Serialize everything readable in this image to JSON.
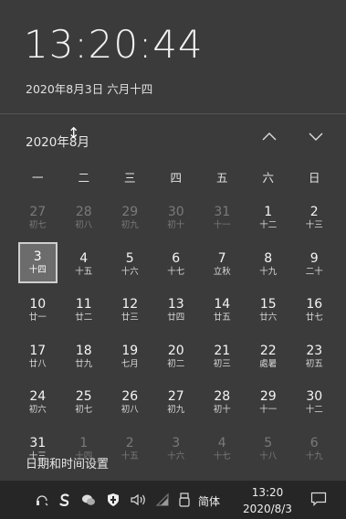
{
  "clock": {
    "time": "13:20:44",
    "long_date": "2020年8月3日 六月十四"
  },
  "calendar": {
    "month_label": "2020年8月",
    "weekdays": [
      "一",
      "二",
      "三",
      "四",
      "五",
      "六",
      "日"
    ],
    "days": [
      {
        "num": "27",
        "lunar": "初七",
        "dim": true
      },
      {
        "num": "28",
        "lunar": "初八",
        "dim": true
      },
      {
        "num": "29",
        "lunar": "初九",
        "dim": true
      },
      {
        "num": "30",
        "lunar": "初十",
        "dim": true
      },
      {
        "num": "31",
        "lunar": "十一",
        "dim": true
      },
      {
        "num": "1",
        "lunar": "十二",
        "dim": false
      },
      {
        "num": "2",
        "lunar": "十三",
        "dim": false
      },
      {
        "num": "3",
        "lunar": "十四",
        "dim": false,
        "today": true
      },
      {
        "num": "4",
        "lunar": "十五",
        "dim": false
      },
      {
        "num": "5",
        "lunar": "十六",
        "dim": false
      },
      {
        "num": "6",
        "lunar": "十七",
        "dim": false
      },
      {
        "num": "7",
        "lunar": "立秋",
        "dim": false
      },
      {
        "num": "8",
        "lunar": "十九",
        "dim": false
      },
      {
        "num": "9",
        "lunar": "二十",
        "dim": false
      },
      {
        "num": "10",
        "lunar": "廿一",
        "dim": false
      },
      {
        "num": "11",
        "lunar": "廿二",
        "dim": false
      },
      {
        "num": "12",
        "lunar": "廿三",
        "dim": false
      },
      {
        "num": "13",
        "lunar": "廿四",
        "dim": false
      },
      {
        "num": "14",
        "lunar": "廿五",
        "dim": false
      },
      {
        "num": "15",
        "lunar": "廿六",
        "dim": false
      },
      {
        "num": "16",
        "lunar": "廿七",
        "dim": false
      },
      {
        "num": "17",
        "lunar": "廿八",
        "dim": false
      },
      {
        "num": "18",
        "lunar": "廿九",
        "dim": false
      },
      {
        "num": "19",
        "lunar": "七月",
        "dim": false
      },
      {
        "num": "20",
        "lunar": "初二",
        "dim": false
      },
      {
        "num": "21",
        "lunar": "初三",
        "dim": false
      },
      {
        "num": "22",
        "lunar": "處暑",
        "dim": false
      },
      {
        "num": "23",
        "lunar": "初五",
        "dim": false
      },
      {
        "num": "24",
        "lunar": "初六",
        "dim": false
      },
      {
        "num": "25",
        "lunar": "初七",
        "dim": false
      },
      {
        "num": "26",
        "lunar": "初八",
        "dim": false
      },
      {
        "num": "27",
        "lunar": "初九",
        "dim": false
      },
      {
        "num": "28",
        "lunar": "初十",
        "dim": false
      },
      {
        "num": "29",
        "lunar": "十一",
        "dim": false
      },
      {
        "num": "30",
        "lunar": "十二",
        "dim": false
      },
      {
        "num": "31",
        "lunar": "十三",
        "dim": false
      },
      {
        "num": "1",
        "lunar": "十四",
        "dim": true
      },
      {
        "num": "2",
        "lunar": "十五",
        "dim": true
      },
      {
        "num": "3",
        "lunar": "十六",
        "dim": true
      },
      {
        "num": "4",
        "lunar": "十七",
        "dim": true
      },
      {
        "num": "5",
        "lunar": "十八",
        "dim": true
      },
      {
        "num": "6",
        "lunar": "十九",
        "dim": true
      }
    ]
  },
  "settings_link": "日期和时间设置",
  "taskbar": {
    "ime_label": "简体",
    "time": "13:20",
    "date": "2020/8/3",
    "icons": [
      "headset-icon",
      "sogou-icon",
      "wechat-icon",
      "shield-icon",
      "volume-icon",
      "wifi-icon",
      "usb-icon"
    ]
  }
}
